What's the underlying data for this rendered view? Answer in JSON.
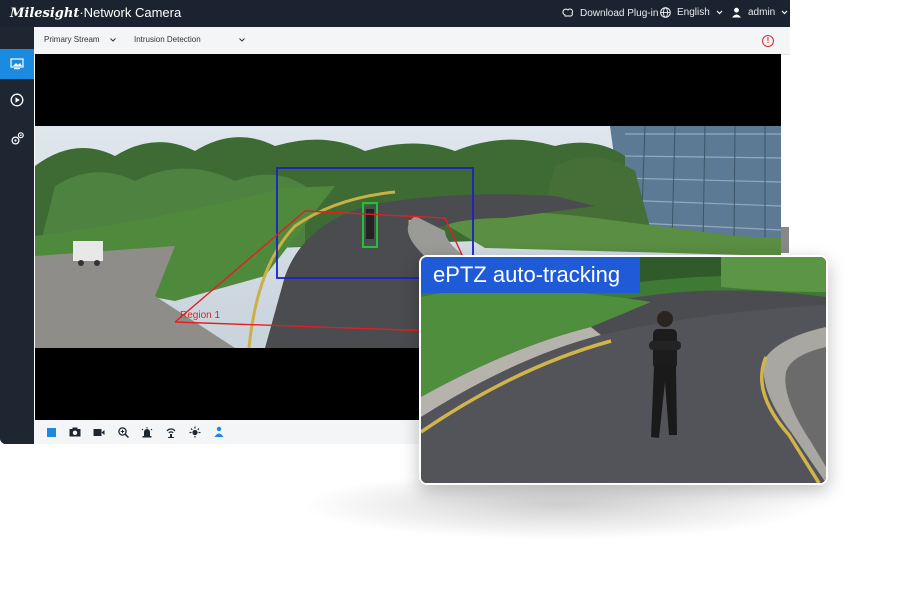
{
  "header": {
    "brand_logo": "Milesight",
    "brand_suffix": "·Network Camera",
    "download_label": "Download Plug-in",
    "language_label": "English",
    "user_label": "admin"
  },
  "toolbar": {
    "stream_select": "Primary Stream",
    "detection_select": "Intrusion Detection",
    "alarm_symbol": "!"
  },
  "video": {
    "region_label": "Region 1"
  },
  "overlay": {
    "title": "ePTZ auto-tracking"
  },
  "sidebar": {
    "items": [
      {
        "icon": "live-view-icon",
        "active": true
      },
      {
        "icon": "playback-icon",
        "active": false
      },
      {
        "icon": "settings-icon",
        "active": false
      }
    ]
  },
  "bottom_toolbar": {
    "icons": [
      "stop-icon",
      "snapshot-icon",
      "record-icon",
      "zoom-icon",
      "alarm-output-icon",
      "audio-icon",
      "light-icon",
      "tracking-icon"
    ]
  },
  "colors": {
    "accent": "#1a8be0",
    "titlebar": "#1b2330",
    "overlay_label": "#1f5bd6",
    "tracking_box": "#1a20c8",
    "target_box": "#21c23a",
    "region_line": "#e02020"
  }
}
